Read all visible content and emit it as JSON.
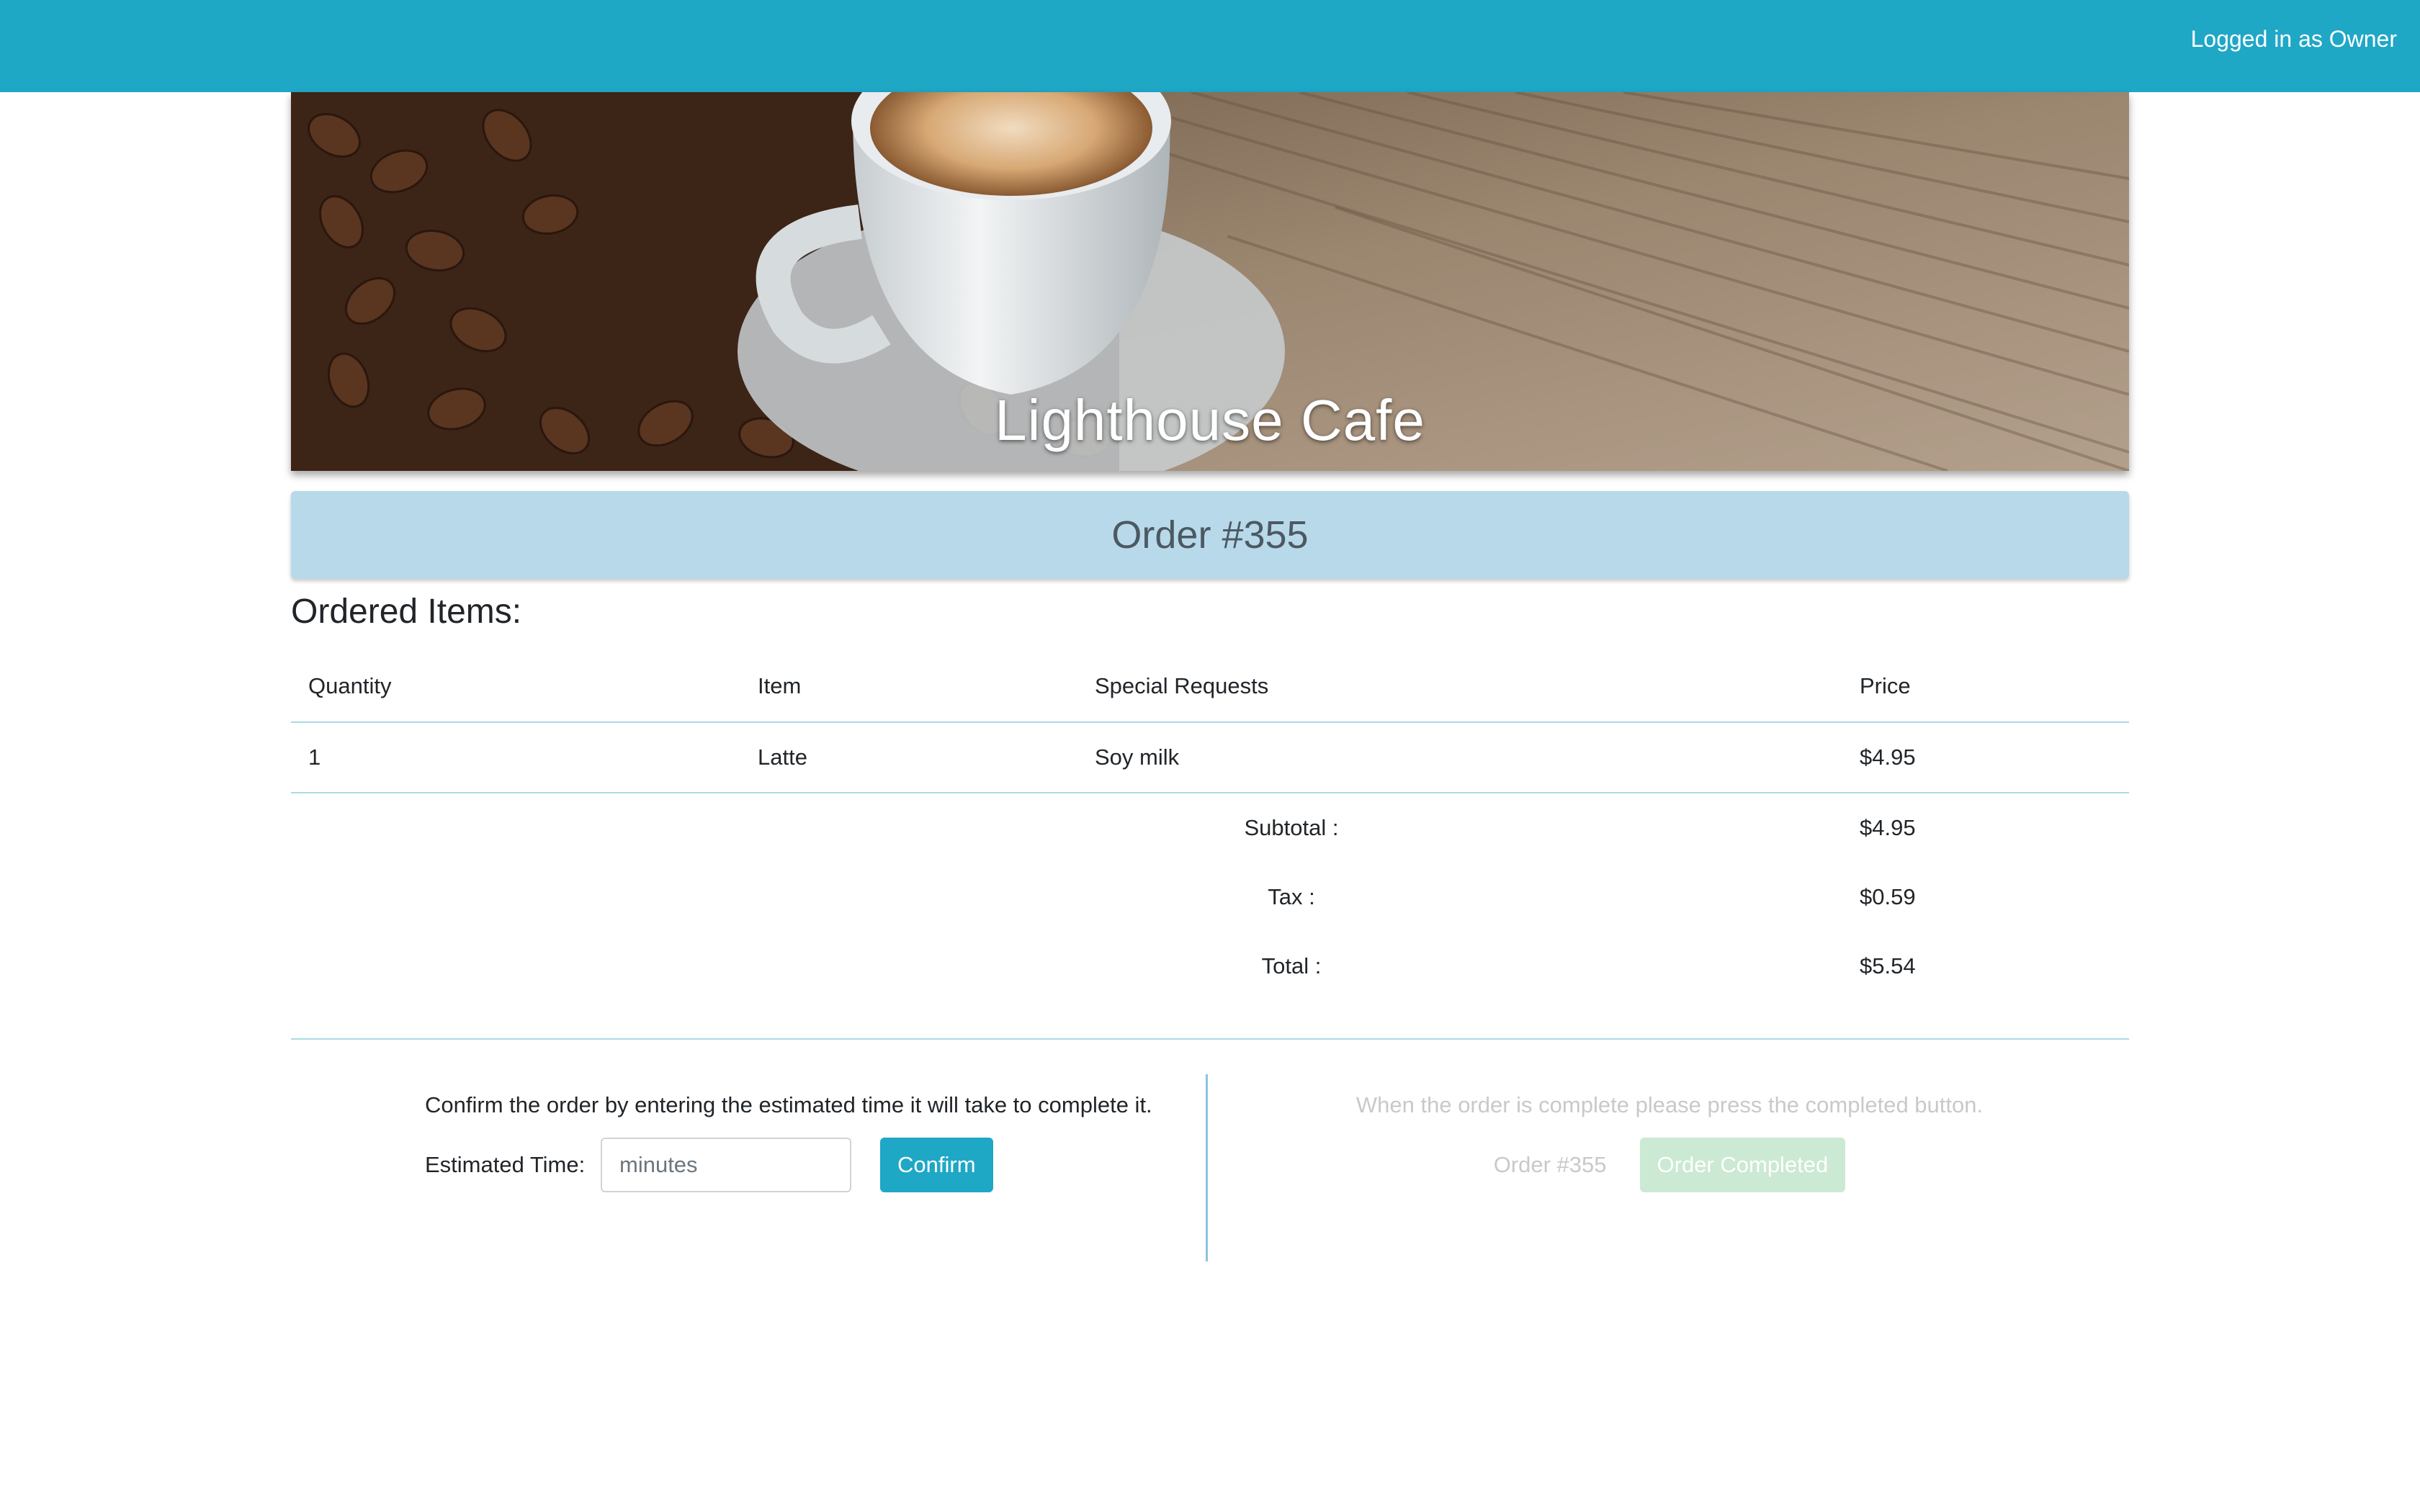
{
  "header": {
    "login_status": "Logged in as Owner"
  },
  "hero": {
    "title": "Lighthouse Cafe"
  },
  "order": {
    "banner_title": "Order #355"
  },
  "items_section": {
    "heading": "Ordered Items:",
    "columns": [
      "Quantity",
      "Item",
      "Special Requests",
      "Price"
    ],
    "rows": [
      {
        "quantity": "1",
        "item": "Latte",
        "special_requests": "Soy milk",
        "price": "$4.95"
      }
    ],
    "summary": {
      "subtotal_label": "Subtotal :",
      "subtotal_value": "$4.95",
      "tax_label": "Tax :",
      "tax_value": "$0.59",
      "total_label": "Total :",
      "total_value": "$5.54"
    }
  },
  "confirm_panel": {
    "instructions": "Confirm the order by entering the estimated time it will take to complete it.",
    "time_label": "Estimated Time:",
    "time_placeholder": "minutes",
    "time_value": "",
    "confirm_label": "Confirm"
  },
  "complete_panel": {
    "instructions": "When the order is complete please press the completed button.",
    "order_label": "Order #355",
    "complete_label": "Order Completed"
  },
  "colors": {
    "brand": "#1fa7c6",
    "banner": "#b8d9ea",
    "completed_disabled": "#cbe9d3"
  }
}
